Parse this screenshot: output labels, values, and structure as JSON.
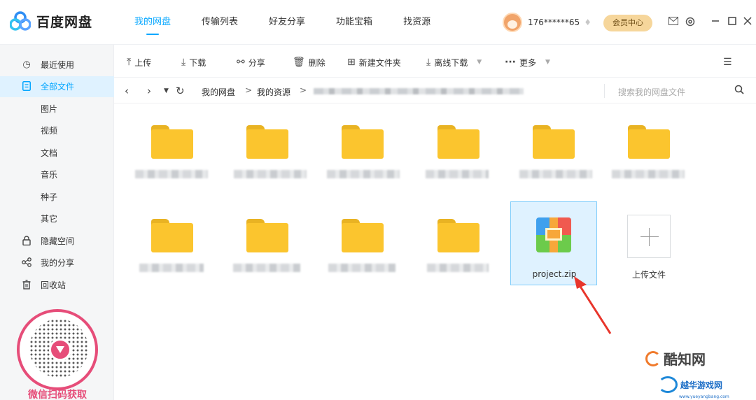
{
  "app": {
    "name": "百度网盘"
  },
  "nav": [
    {
      "label": "我的网盘",
      "active": true
    },
    {
      "label": "传输列表",
      "active": false
    },
    {
      "label": "好友分享",
      "active": false
    },
    {
      "label": "功能宝箱",
      "active": false
    },
    {
      "label": "找资源",
      "active": false
    }
  ],
  "user": {
    "name": "176******65",
    "vip_label": "会员中心"
  },
  "window_icons": [
    "mail-icon",
    "settings-icon",
    "minimize-icon",
    "maximize-icon",
    "close-icon"
  ],
  "sidebar": {
    "items": [
      {
        "label": "最近使用",
        "icon": "clock-icon"
      },
      {
        "label": "全部文件",
        "icon": "file-icon",
        "active": true
      },
      {
        "label": "图片"
      },
      {
        "label": "视频"
      },
      {
        "label": "文档"
      },
      {
        "label": "音乐"
      },
      {
        "label": "种子"
      },
      {
        "label": "其它"
      },
      {
        "label": "隐藏空间",
        "icon": "lock-icon"
      },
      {
        "label": "我的分享",
        "icon": "share-icon"
      },
      {
        "label": "回收站",
        "icon": "trash-icon"
      }
    ]
  },
  "promo": {
    "qr_caption": "微信扫码获取"
  },
  "toolbar": {
    "upload": "上传",
    "download": "下载",
    "share": "分享",
    "delete": "删除",
    "new_folder": "新建文件夹",
    "offline_download": "离线下载",
    "more": "更多"
  },
  "address": {
    "crumbs": [
      "我的网盘",
      "我的资源"
    ],
    "search_placeholder": "搜索我的网盘文件"
  },
  "files": {
    "zip_name": "project.zip",
    "upload_label": "上传文件"
  },
  "colors": {
    "accent": "#06a7ff",
    "folder": "#fbc52e",
    "annotation": "#e8352b"
  },
  "watermarks": {
    "site1": "酷知网",
    "site2": "越华游戏网",
    "site2_url": "www.yueyangbang.com"
  }
}
